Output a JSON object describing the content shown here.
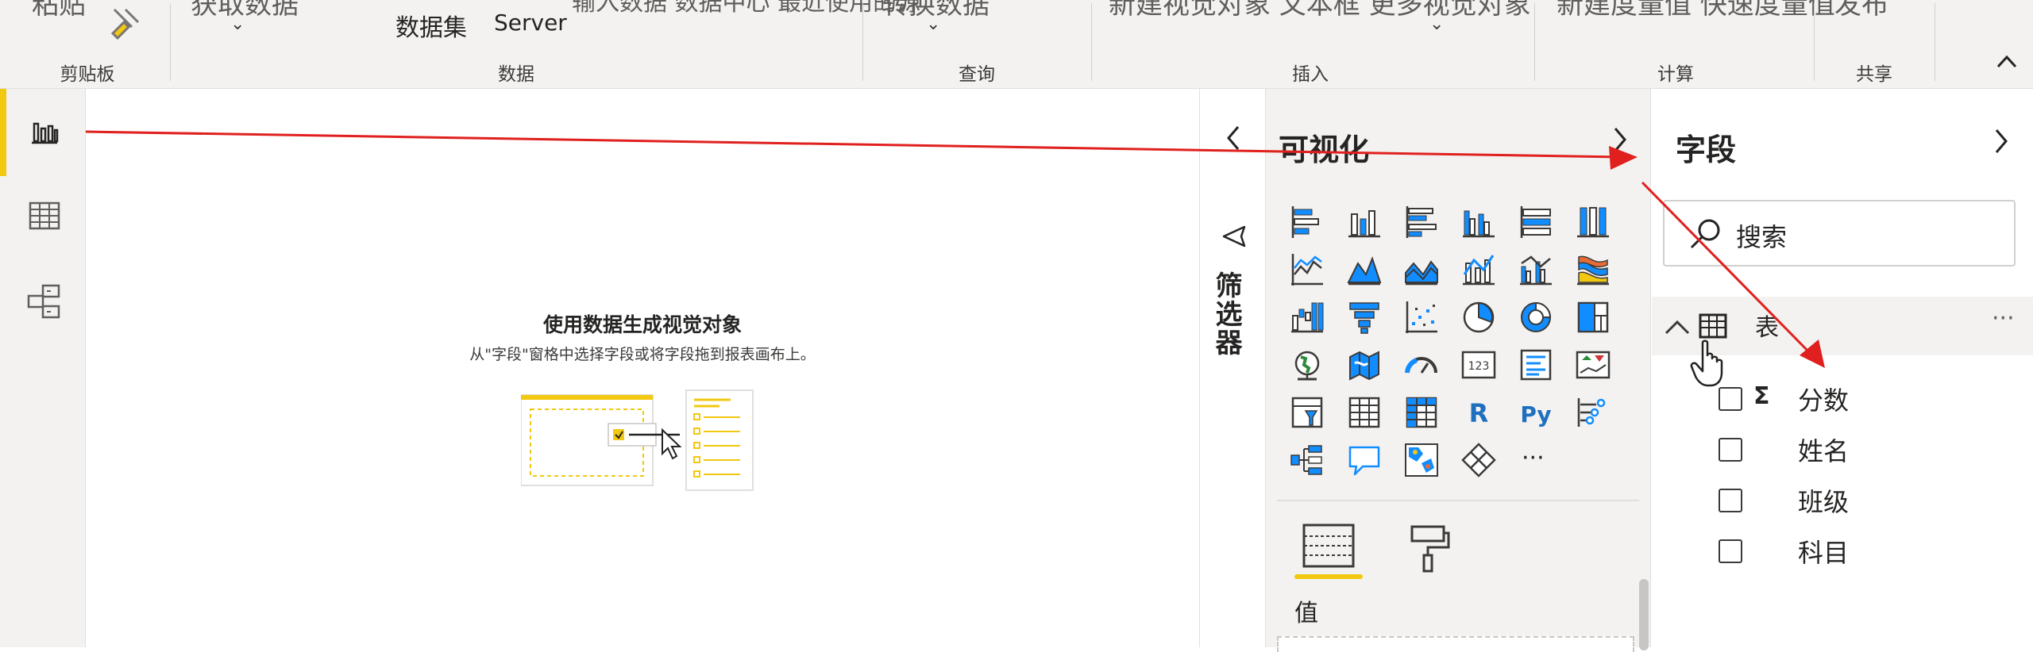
{
  "ribbon": {
    "cut_texts": [
      "粘贴",
      "获取数据",
      "数据集",
      "输入数据 数据中心 最近使用的源",
      "转换数据",
      "新建视觉对象 文本框 更多视觉对象",
      "新建度量值 快速度量值",
      "发布"
    ],
    "dataset_label": "数据集",
    "server_label": "Server",
    "groups": [
      "剪贴板",
      "数据",
      "查询",
      "插入",
      "计算",
      "共享"
    ]
  },
  "canvas": {
    "empty_title": "使用数据生成视觉对象",
    "empty_subtitle": "从\"字段\"窗格中选择字段或将字段拖到报表画布上。"
  },
  "filters": {
    "label": "筛选器"
  },
  "viz": {
    "title": "可视化",
    "more_label": "···",
    "values_label": "值"
  },
  "fields": {
    "title": "字段",
    "search_placeholder": "搜索",
    "table_name": "表",
    "more_label": "···",
    "items": [
      {
        "label": "分数",
        "sigma": "Σ"
      },
      {
        "label": "姓名",
        "sigma": ""
      },
      {
        "label": "班级",
        "sigma": ""
      },
      {
        "label": "科目",
        "sigma": ""
      }
    ]
  },
  "colors": {
    "accent": "#f2c811",
    "arrow": "#e0201e",
    "viz_blue": "#118dff",
    "viz_dark": "#3b3a39"
  }
}
